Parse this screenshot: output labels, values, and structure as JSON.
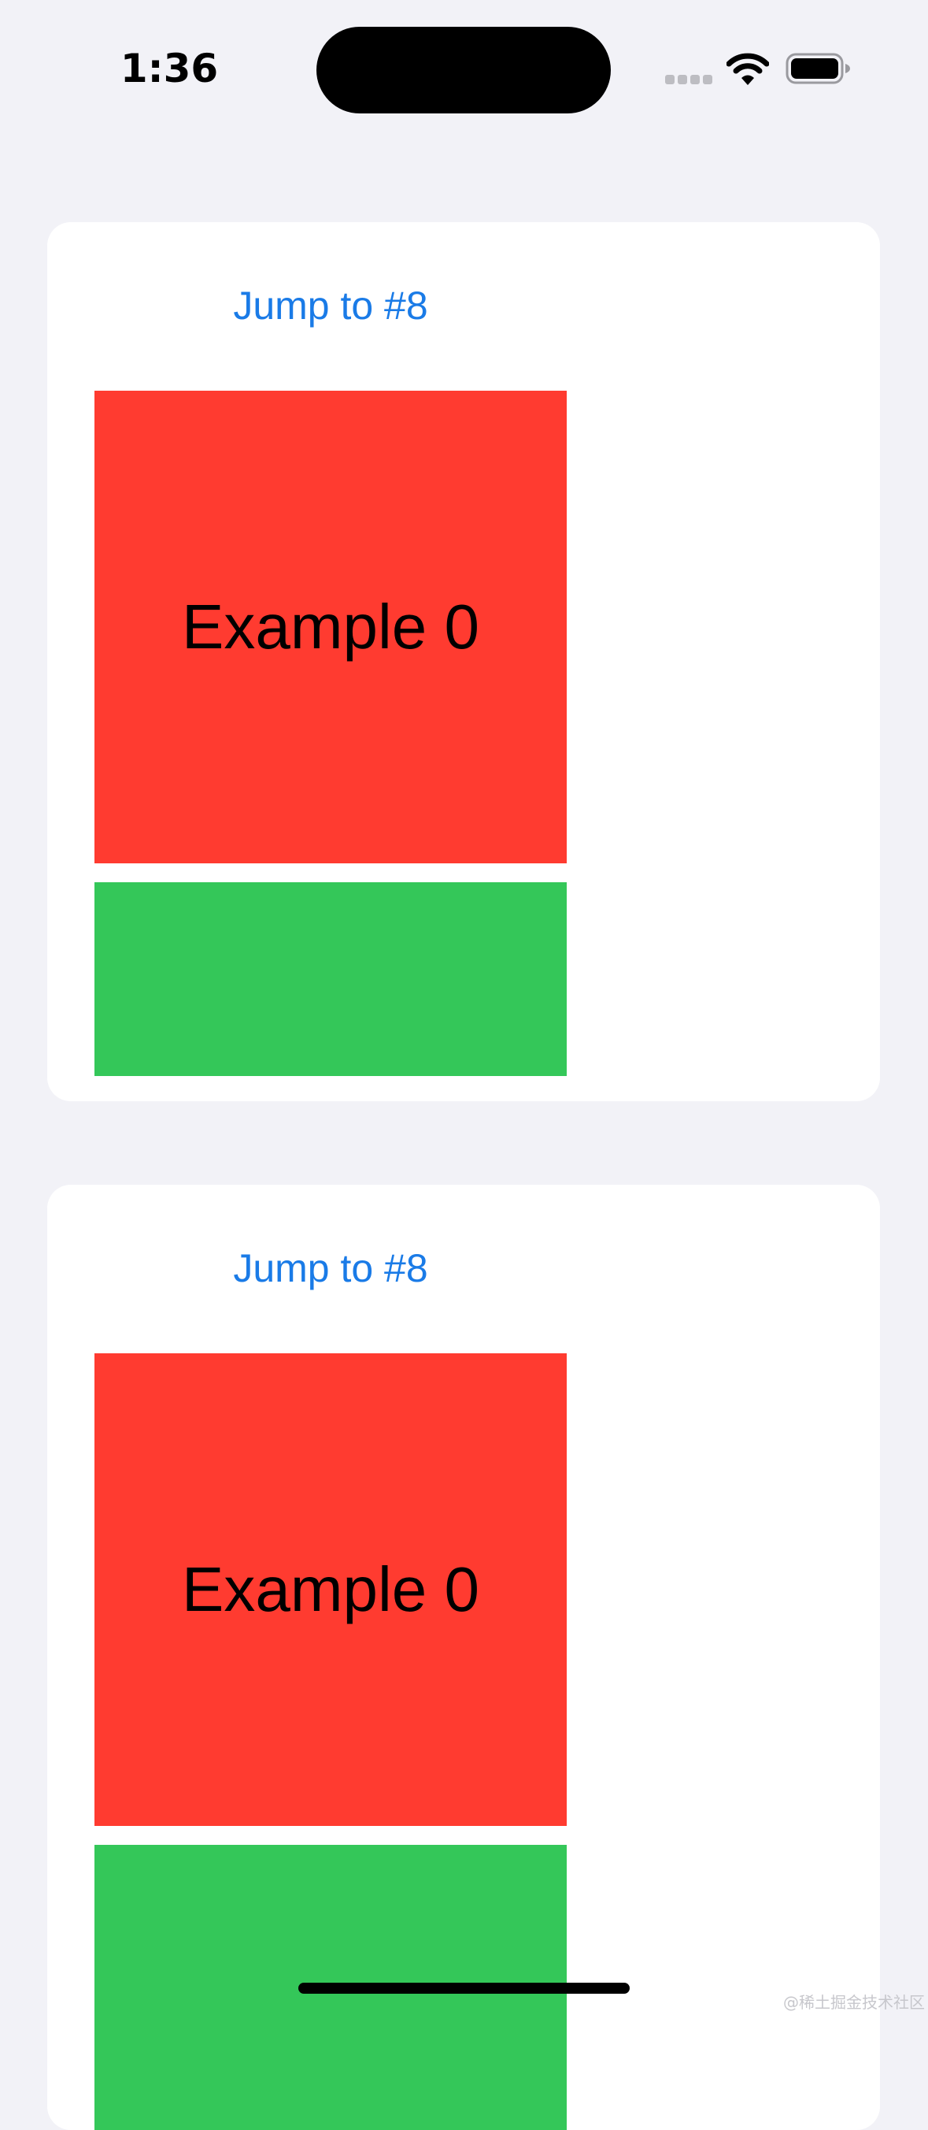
{
  "status_bar": {
    "time": "1:36",
    "icons": [
      "cellular-signal-icon",
      "wifi-icon",
      "battery-icon"
    ]
  },
  "cards": [
    {
      "link_label": "Jump to #8",
      "box_label": "Example 0"
    },
    {
      "link_label": "Jump to #8",
      "box_label": "Example 0"
    }
  ],
  "colors": {
    "background": "#F2F2F7",
    "card": "#FFFFFF",
    "link": "#1A7BE7",
    "red": "#FF3B30",
    "green": "#34C759"
  },
  "watermark": "@稀土掘金技术社区"
}
